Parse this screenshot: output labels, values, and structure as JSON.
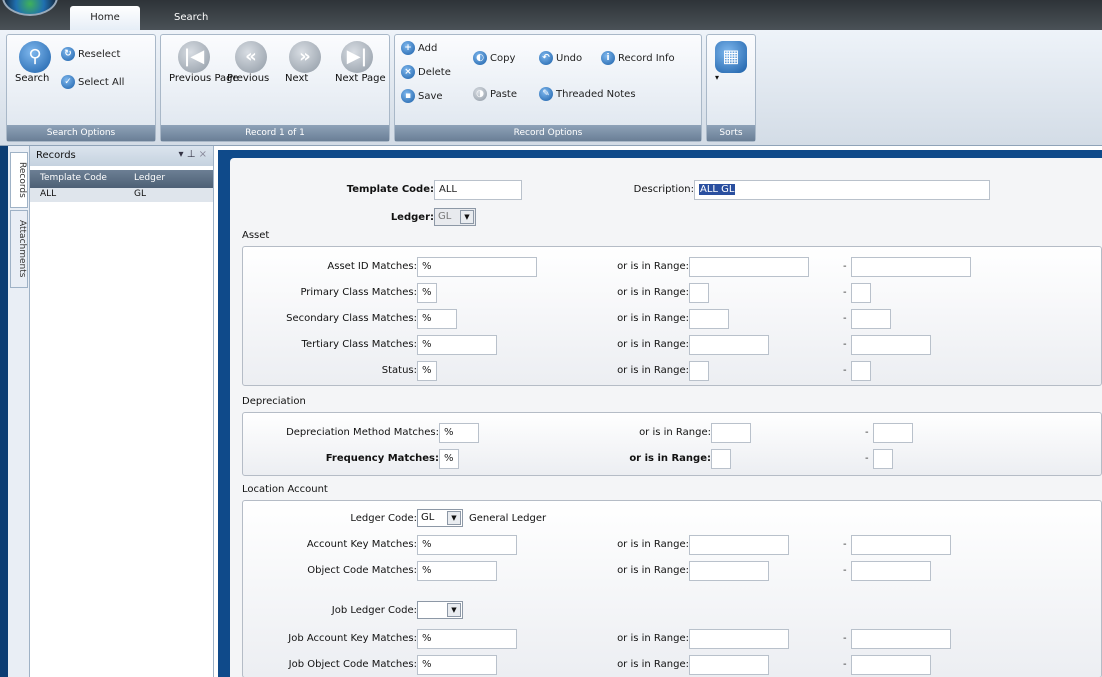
{
  "tabs": [
    {
      "label": "Home"
    },
    {
      "label": "Search"
    }
  ],
  "ribbon": {
    "search_options": {
      "group_label": "Search Options",
      "search": "Search",
      "reselect": "Reselect",
      "select_all": "Select All"
    },
    "record_nav": {
      "group_label": "Record 1 of 1",
      "previous_page": "Previous Page",
      "previous": "Previous",
      "next": "Next",
      "next_page": "Next Page"
    },
    "record_options": {
      "group_label": "Record Options",
      "add": "Add",
      "delete": "Delete",
      "save": "Save",
      "copy": "Copy",
      "paste": "Paste",
      "undo": "Undo",
      "record_info": "Record Info",
      "threaded_notes": "Threaded Notes"
    },
    "sorts": {
      "group_label": "Sorts"
    }
  },
  "side_tabs": [
    "Records",
    "Attachments"
  ],
  "records_panel": {
    "title": "Records",
    "columns": [
      "Template Code",
      "Ledger"
    ],
    "rows": [
      {
        "template_code": "ALL",
        "ledger": "GL"
      }
    ]
  },
  "form": {
    "template_code_label": "Template Code:",
    "template_code_value": "ALL",
    "description_label": "Description:",
    "description_value": "ALL GL",
    "ledger_label": "Ledger:",
    "ledger_value": "GL",
    "asset": {
      "title": "Asset",
      "range_label": "or is in Range:",
      "rows": [
        {
          "label": "Asset ID Matches:",
          "value": "%"
        },
        {
          "label": "Primary Class Matches:",
          "value": "%"
        },
        {
          "label": "Secondary Class Matches:",
          "value": "%"
        },
        {
          "label": "Tertiary Class Matches:",
          "value": "%"
        },
        {
          "label": "Status:",
          "value": "%"
        }
      ]
    },
    "depreciation": {
      "title": "Depreciation",
      "range_label": "or is in Range:",
      "rows": [
        {
          "label": "Depreciation Method Matches:",
          "value": "%"
        },
        {
          "label": "Frequency Matches:",
          "value": "%"
        }
      ]
    },
    "location_account": {
      "title": "Location Account",
      "ledger_code_label": "Ledger Code:",
      "ledger_code_value": "GL",
      "ledger_code_desc": "General Ledger",
      "range_label": "or is in Range:",
      "rows": [
        {
          "label": "Account Key Matches:",
          "value": "%"
        },
        {
          "label": "Object Code Matches:",
          "value": "%"
        }
      ],
      "job_ledger_code_label": "Job Ledger Code:",
      "job_ledger_code_value": "",
      "job_rows": [
        {
          "label": "Job Account Key Matches:",
          "value": "%"
        },
        {
          "label": "Job Object Code Matches:",
          "value": "%"
        }
      ]
    }
  }
}
